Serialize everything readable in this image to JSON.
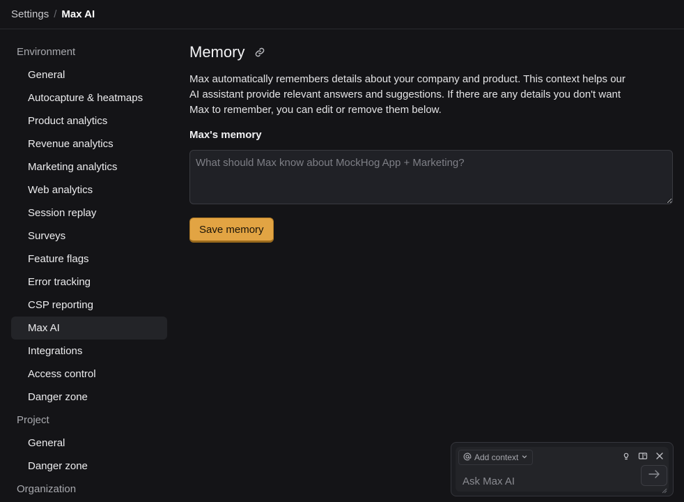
{
  "breadcrumb": {
    "parent": "Settings",
    "separator": "/",
    "current": "Max AI"
  },
  "sidebar": {
    "sections": [
      {
        "title": "Environment",
        "items": [
          {
            "label": "General"
          },
          {
            "label": "Autocapture & heatmaps"
          },
          {
            "label": "Product analytics"
          },
          {
            "label": "Revenue analytics"
          },
          {
            "label": "Marketing analytics"
          },
          {
            "label": "Web analytics"
          },
          {
            "label": "Session replay"
          },
          {
            "label": "Surveys"
          },
          {
            "label": "Feature flags"
          },
          {
            "label": "Error tracking"
          },
          {
            "label": "CSP reporting"
          },
          {
            "label": "Max AI",
            "active": true
          },
          {
            "label": "Integrations"
          },
          {
            "label": "Access control"
          },
          {
            "label": "Danger zone"
          }
        ]
      },
      {
        "title": "Project",
        "items": [
          {
            "label": "General"
          },
          {
            "label": "Danger zone"
          }
        ]
      },
      {
        "title": "Organization",
        "items": []
      }
    ]
  },
  "main": {
    "title": "Memory",
    "title_icon": "link-icon",
    "description": "Max automatically remembers details about your company and product. This context helps our AI assistant provide relevant answers and suggestions. If there are any details you don't want Max to remember, you can edit or remove them below.",
    "field_label": "Max's memory",
    "memory_value": "",
    "memory_placeholder": "What should Max know about MockHog App + Marketing?",
    "save_label": "Save memory"
  },
  "chat": {
    "add_context_label": "Add context",
    "ask_placeholder": "Ask Max AI",
    "tools": [
      "lightbulb-icon",
      "open-panel-icon",
      "close-icon"
    ]
  },
  "colors": {
    "background": "#141417",
    "accent": "#e2a443",
    "input_background": "#202126",
    "active_nav": "#232428"
  }
}
